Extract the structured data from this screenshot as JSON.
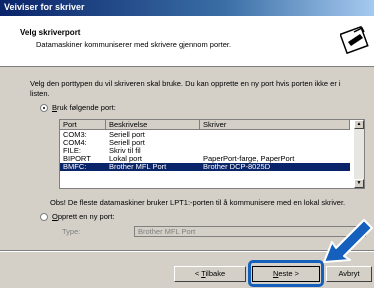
{
  "window": {
    "title": "Veiviser for skriver"
  },
  "header": {
    "title": "Velg skriverport",
    "subtitle": "Datamaskiner kommuniserer med skrivere gjennom porter."
  },
  "instructions": "Velg den porttypen du vil skriveren skal bruke. Du kan opprette en ny port hvis porten ikke er i listen.",
  "use_port": {
    "label_accel": "B",
    "label_rest": "ruk følgende port:",
    "selected": true
  },
  "port_list": {
    "columns": [
      "Port",
      "Beskrivelse",
      "Skriver"
    ],
    "rows": [
      [
        "COM3:",
        "Seriell port",
        ""
      ],
      [
        "COM4:",
        "Seriell port",
        ""
      ],
      [
        "FILE:",
        "Skriv til fil",
        ""
      ],
      [
        "BIPORT",
        "Lokal port",
        "PaperPort-farge, PaperPort"
      ],
      [
        "BMFC:",
        "Brother MFL Port",
        "Brother DCP-8025D"
      ]
    ],
    "selected_row": 4
  },
  "note": "Obs!  De fleste datamaskiner bruker LPT1:-porten til å kommunisere med en lokal skriver.",
  "create_port": {
    "label_accel": "O",
    "label_rest": "pprett en ny port:",
    "selected": false,
    "type_label": "Type:",
    "type_value": "Brother MFL Port"
  },
  "buttons": {
    "back_pre": "< ",
    "back_accel": "T",
    "back_rest": "ilbake",
    "next_accel": "N",
    "next_rest": "este >",
    "cancel": "Avbryt"
  },
  "colors": {
    "title_bar": "#0a246a",
    "selection": "#0a246a",
    "callout": "#1560bd"
  }
}
